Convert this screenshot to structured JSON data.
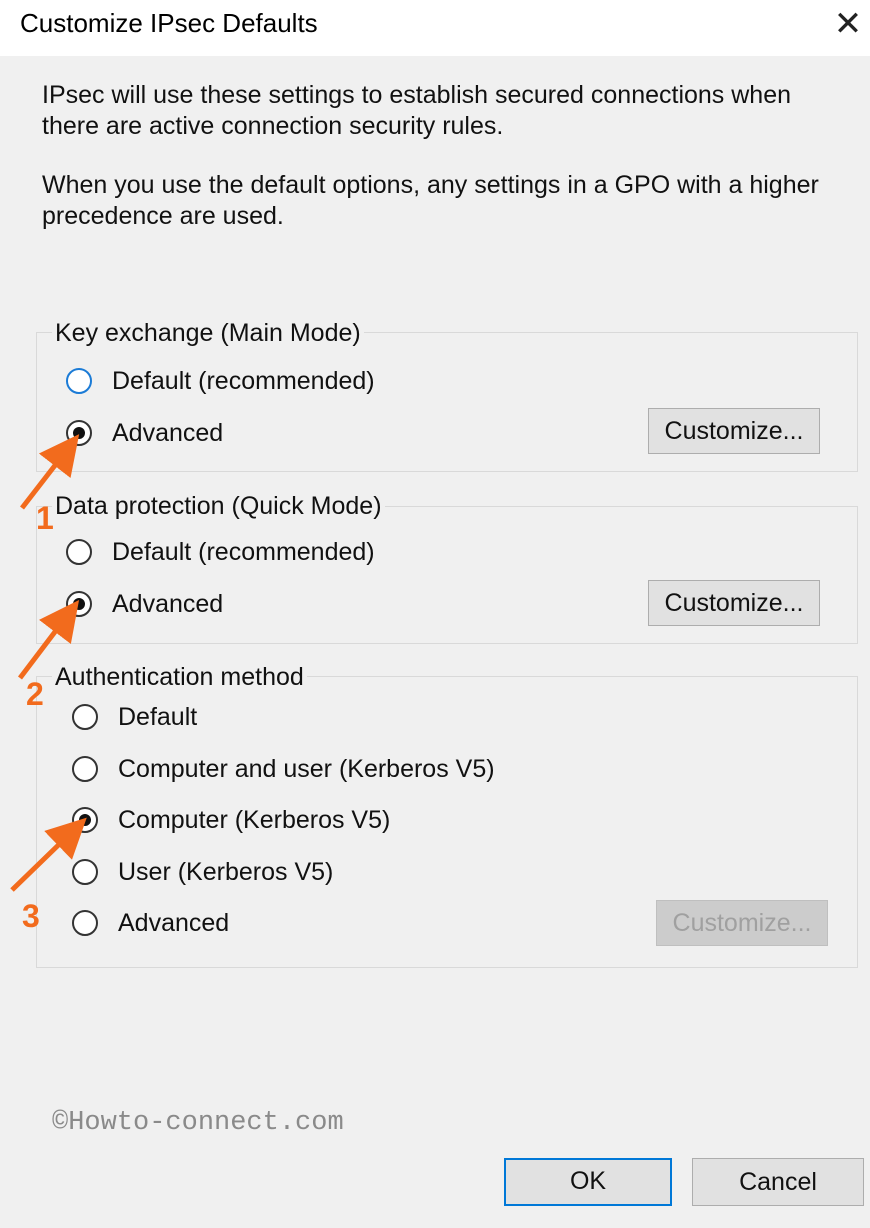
{
  "window": {
    "title": "Customize IPsec Defaults",
    "close_glyph": "✕"
  },
  "intro": {
    "line1": "IPsec will use these settings to establish secured connections when there are active connection security rules.",
    "line2": "When you use the default options, any settings in a GPO with a higher precedence are used."
  },
  "key_exchange": {
    "legend": "Key exchange (Main Mode)",
    "options": [
      "Default (recommended)",
      "Advanced"
    ],
    "selected": "Advanced",
    "customize_label": "Customize..."
  },
  "data_protection": {
    "legend": "Data protection (Quick Mode)",
    "options": [
      "Default (recommended)",
      "Advanced"
    ],
    "selected": "Advanced",
    "customize_label": "Customize..."
  },
  "authentication": {
    "legend": "Authentication method",
    "options": [
      "Default",
      "Computer and user (Kerberos V5)",
      "Computer (Kerberos V5)",
      "User (Kerberos V5)",
      "Advanced"
    ],
    "selected": "Computer (Kerberos V5)",
    "customize_label": "Customize...",
    "customize_enabled": false
  },
  "annotations": [
    "1",
    "2",
    "3"
  ],
  "watermark": "©Howto-connect.com",
  "footer": {
    "ok_label": "OK",
    "cancel_label": "Cancel"
  },
  "colors": {
    "annotation": "#f26b1d",
    "focus_border": "#0078d7"
  }
}
